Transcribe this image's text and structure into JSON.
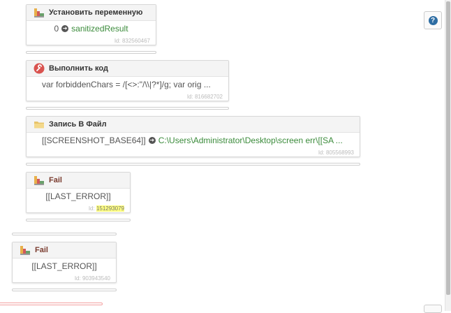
{
  "blocks": [
    {
      "title": "Установить переменную",
      "body_prefix": "0",
      "body_value": "sanitizedResult",
      "id_label": "Id:",
      "id": "832560467"
    },
    {
      "title": "Выполнить код",
      "body": "var forbiddenChars = /[<>:\"/\\\\|?*]/g; var orig ...",
      "id_label": "Id:",
      "id": "816682702"
    },
    {
      "title": "Запись В Файл",
      "body_prefix": "[[SCREENSHOT_BASE64]]",
      "body_value": "C:\\Users\\Administrator\\Desktop\\screen err\\[[SA ...",
      "id_label": "Id:",
      "id": "805568993"
    },
    {
      "title": "Fail",
      "body": "[[LAST_ERROR]]",
      "id_label": "Id:",
      "id": "151293079"
    },
    {
      "title": "Fail",
      "body": "[[LAST_ERROR]]",
      "id_label": "Id:",
      "id": "903943540"
    }
  ],
  "icons": {
    "set_variable": "variable-blocks-icon",
    "execute_code": "wrench-icon",
    "write_file": "folder-icon",
    "fail": "variable-blocks-icon",
    "help": "question-icon",
    "arrow": "arrow-right-circle-icon"
  },
  "colors": {
    "value_green": "#3b8b3b",
    "fail_title": "#7a3b2e",
    "id_highlight": "#ffff80",
    "help_blue": "#2d6da3"
  }
}
